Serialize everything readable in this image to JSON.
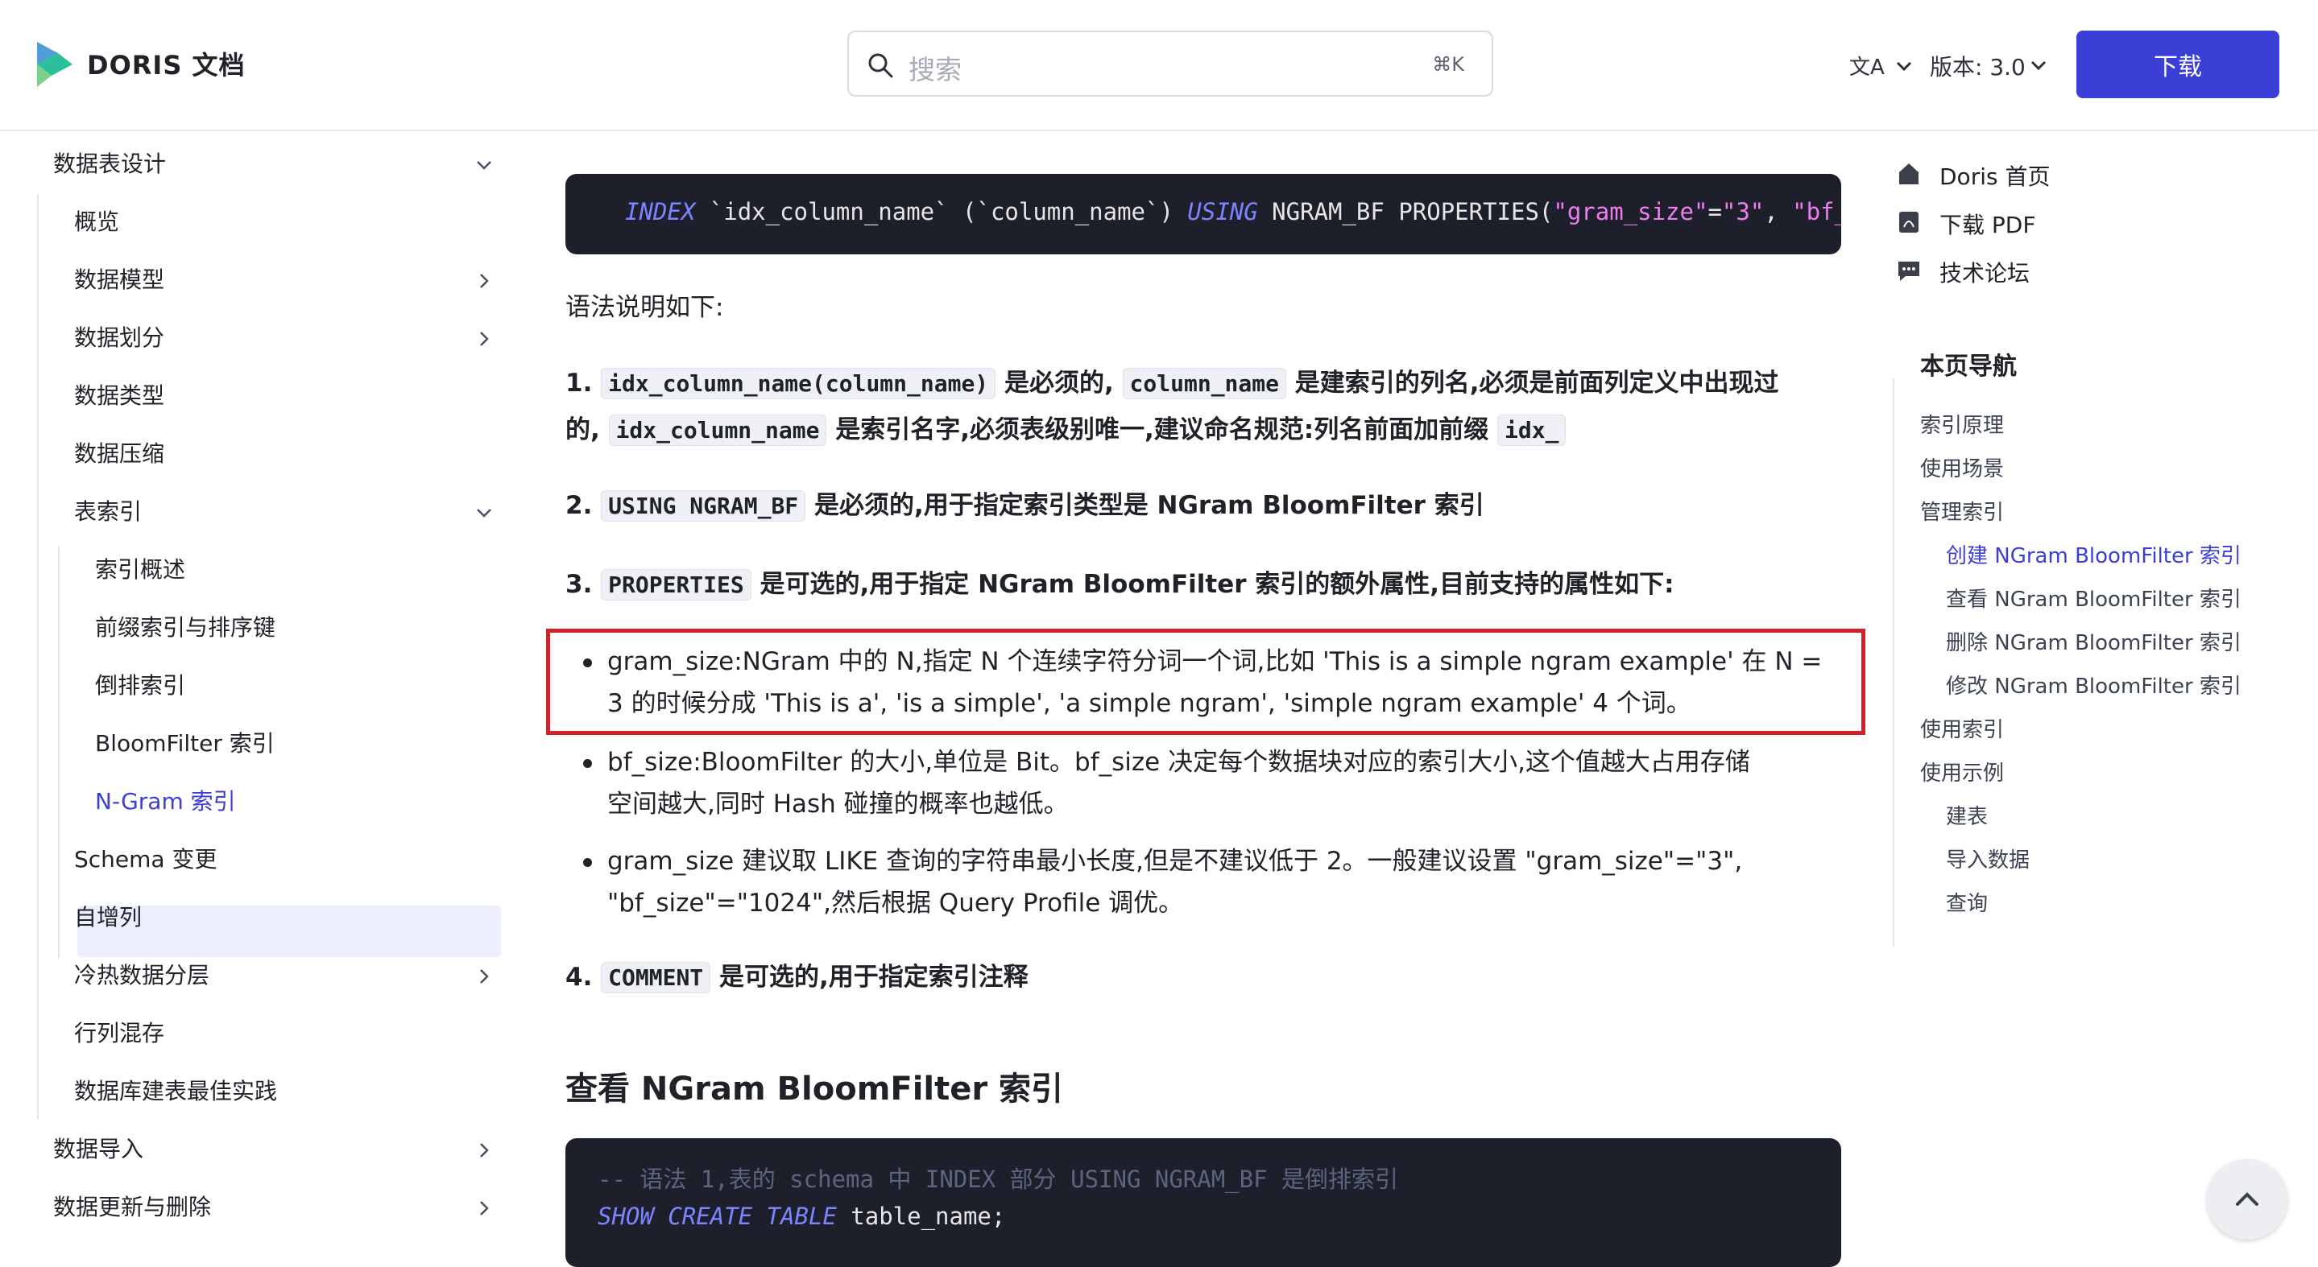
{
  "header": {
    "brand": "DORIS 文档",
    "search_placeholder": "搜索",
    "search_shortcut": "⌘K",
    "version_label": "版本: 3.0",
    "download_label": "下载",
    "accent_color": "#3b3fd6"
  },
  "sidebar": {
    "items": [
      {
        "label": "数据表设计"
      },
      {
        "label": "概览"
      },
      {
        "label": "数据模型"
      },
      {
        "label": "数据划分"
      },
      {
        "label": "数据类型"
      },
      {
        "label": "数据压缩"
      },
      {
        "label": "表索引"
      },
      {
        "label": "索引概述"
      },
      {
        "label": "前缀索引与排序键"
      },
      {
        "label": "倒排索引"
      },
      {
        "label": "BloomFilter 索引"
      },
      {
        "label": "N-Gram 索引"
      },
      {
        "label": "Schema 变更"
      },
      {
        "label": "自增列"
      },
      {
        "label": "冷热数据分层"
      },
      {
        "label": "行列混存"
      },
      {
        "label": "数据库建表最佳实践"
      },
      {
        "label": "数据导入"
      },
      {
        "label": "数据更新与删除"
      }
    ]
  },
  "content": {
    "code1": {
      "kw_index": "INDEX",
      "t1": " `idx_column_name` (`column_name`) ",
      "kw_using": "USING",
      "t2": " NGRAM_BF PROPERTIES(",
      "s1": "\"gram_size\"",
      "t3": "=",
      "s2": "\"3\"",
      "t4": ", ",
      "s3": "\"bf_size\""
    },
    "intro": "语法说明如下:",
    "p1": {
      "num": "1.",
      "c1": "idx_column_name(column_name)",
      "t1": "是必须的,",
      "c2": "column_name",
      "t2": "是建索引的列名,必须是前面列定义中出现过",
      "t3": "的,",
      "c3": "idx_column_name",
      "t4": "是索引名字,必须表级别唯一,建议命名规范:列名前面加前缀",
      "c4": "idx_"
    },
    "p2": {
      "num": "2.",
      "c1": "USING NGRAM_BF",
      "t1": "是必须的,用于指定索引类型是 NGram BloomFilter 索引"
    },
    "p3": {
      "num": "3.",
      "c1": "PROPERTIES",
      "t1": "是可选的,用于指定 NGram BloomFilter 索引的额外属性,目前支持的属性如下:"
    },
    "bullets": [
      {
        "l1": "gram_size:NGram 中的 N,指定 N 个连续字符分词一个词,比如 'This is a simple ngram example' 在 N =",
        "l2": "3 的时候分成 'This is a', 'is a simple', 'a simple ngram', 'simple ngram example' 4 个词。"
      },
      {
        "l1": "bf_size:BloomFilter 的大小,单位是 Bit。bf_size 决定每个数据块对应的索引大小,这个值越大占用存储",
        "l2": "空间越大,同时 Hash 碰撞的概率也越低。"
      },
      {
        "l1": "gram_size 建议取 LIKE 查询的字符串最小长度,但是不建议低于 2。一般建议设置 \"gram_size\"=\"3\",",
        "l2": "\"bf_size\"=\"1024\",然后根据 Query Profile 调优。"
      }
    ],
    "p4": {
      "num": "4.",
      "c1": "COMMENT",
      "t1": "是可选的,用于指定索引注释"
    },
    "section_heading": "查看 NGram BloomFilter 索引",
    "code2": {
      "comment": "-- 语法 1,表的 schema 中 INDEX 部分 USING NGRAM_BF 是倒排索引",
      "kw": "SHOW CREATE TABLE",
      "rest": " table_name;"
    }
  },
  "right": {
    "links": [
      {
        "label": "Doris 首页",
        "icon": "home-icon"
      },
      {
        "label": "下载 PDF",
        "icon": "pdf-icon"
      },
      {
        "label": "技术论坛",
        "icon": "forum-icon"
      }
    ],
    "toc_title": "本页导航",
    "toc": [
      {
        "label": "索引原理"
      },
      {
        "label": "使用场景"
      },
      {
        "label": "管理索引"
      },
      {
        "label": "创建 NGram BloomFilter 索引"
      },
      {
        "label": "查看 NGram BloomFilter 索引"
      },
      {
        "label": "删除 NGram BloomFilter 索引"
      },
      {
        "label": "修改 NGram BloomFilter 索引"
      },
      {
        "label": "使用索引"
      },
      {
        "label": "使用示例"
      },
      {
        "label": "建表"
      },
      {
        "label": "导入数据"
      },
      {
        "label": "查询"
      }
    ]
  }
}
